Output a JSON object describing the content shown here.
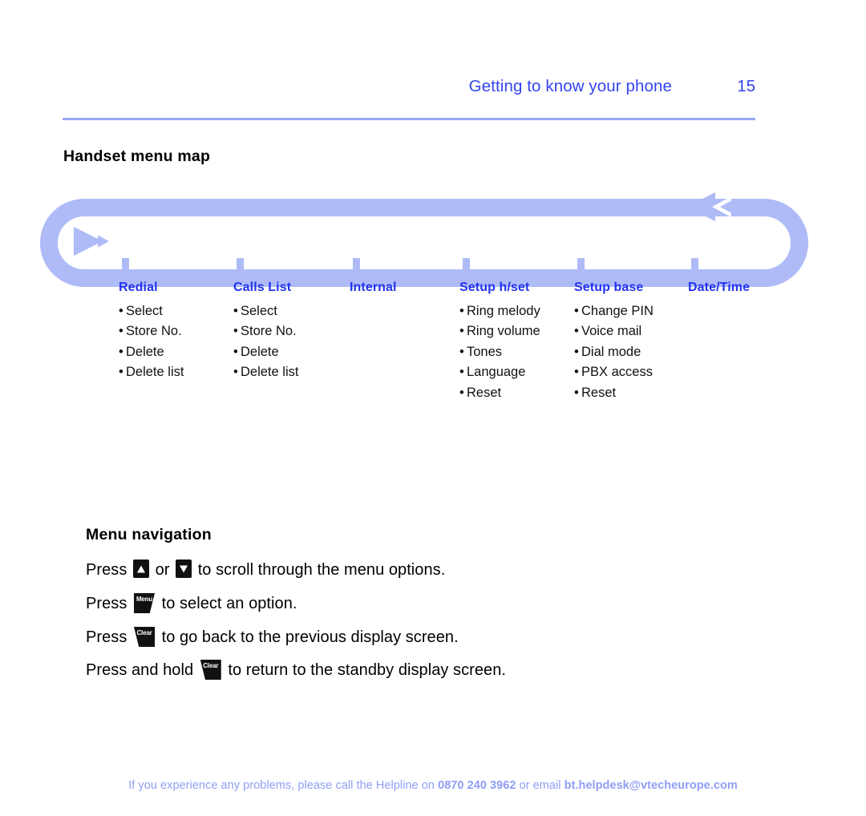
{
  "header": {
    "title": "Getting to know your phone",
    "page_number": "15",
    "accent_color": "#3344ee",
    "rule_color": "#9aa8f7"
  },
  "sections": {
    "menu_map_heading": "Handset menu map",
    "menu_nav_heading": "Menu navigation"
  },
  "menu_map": {
    "loop_color": "#aebbf7",
    "title_color": "#2233ee",
    "columns": [
      {
        "title": "Redial",
        "items": [
          "Select",
          "Store No.",
          "Delete",
          "Delete list"
        ]
      },
      {
        "title": "Calls List",
        "items": [
          "Select",
          "Store No.",
          "Delete",
          "Delete list"
        ]
      },
      {
        "title": "Internal",
        "items": []
      },
      {
        "title": "Setup h/set",
        "items": [
          "Ring melody",
          "Ring volume",
          "Tones",
          "Language",
          "Reset"
        ]
      },
      {
        "title": "Setup base",
        "items": [
          "Change PIN",
          "Voice mail",
          "Dial mode",
          "PBX access",
          "Reset"
        ]
      },
      {
        "title": "Date/Time",
        "items": []
      }
    ],
    "bullet": "•"
  },
  "menu_navigation": {
    "lines": [
      {
        "prefix": "Press",
        "key1": "up-arrow",
        "middle": "or",
        "key2": "down-arrow",
        "suffix": "to scroll through the menu options."
      },
      {
        "prefix": "Press",
        "key1": "Menu",
        "suffix": "to select an option."
      },
      {
        "prefix": "Press",
        "key1": "Clear",
        "suffix": "to go back to the previous display screen."
      },
      {
        "prefix": "Press and hold",
        "key1": "Clear",
        "suffix": "to return to the standby display screen."
      }
    ]
  },
  "footer": {
    "text_before": "If you experience any problems, please call the Helpline on",
    "phone": "0870 240 3962",
    "text_middle": "or email",
    "email": "bt.helpdesk@vtecheurope.com",
    "color": "#8f9ef5"
  }
}
